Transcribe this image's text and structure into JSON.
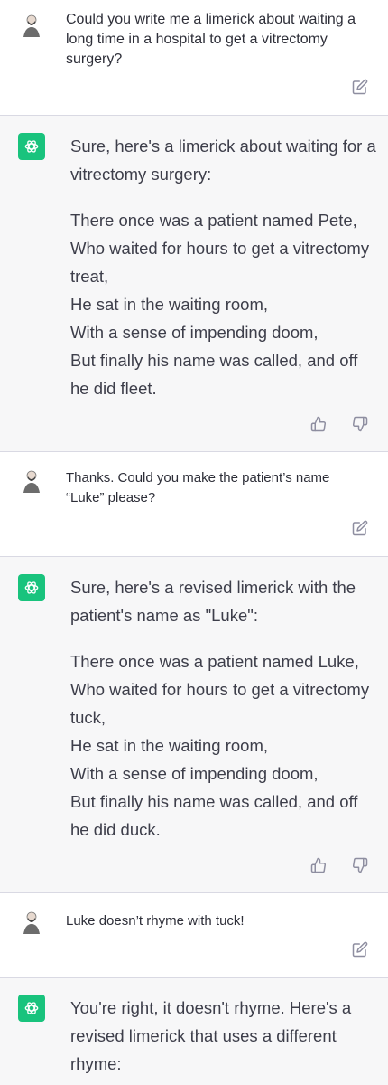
{
  "conversation": {
    "messages": [
      {
        "role": "user",
        "text": "Could you write me a limerick about waiting a long time in a hospital to get a vitrectomy surgery?"
      },
      {
        "role": "assistant",
        "intro": "Sure, here's a limerick about waiting for a vitrectomy surgery:",
        "lines": [
          "There once was a patient named Pete,",
          "Who waited for hours to get a vitrectomy treat,",
          "He sat in the waiting room,",
          "With a sense of impending doom,",
          "But finally his name was called, and off he did fleet."
        ]
      },
      {
        "role": "user",
        "text": "Thanks. Could you make the patient’s name “Luke” please?"
      },
      {
        "role": "assistant",
        "intro": "Sure, here's a revised limerick with the patient's name as \"Luke\":",
        "lines": [
          "There once was a patient named Luke,",
          "Who waited for hours to get a vitrectomy tuck,",
          "He sat in the waiting room,",
          "With a sense of impending doom,",
          "But finally his name was called, and off he did duck."
        ]
      },
      {
        "role": "user",
        "text": "Luke doesn’t rhyme with tuck!"
      },
      {
        "role": "assistant",
        "intro": "You're right, it doesn't rhyme. Here's a revised limerick that uses a different rhyme:"
      }
    ]
  },
  "icons": {
    "user_avatar": "user-avatar-icon",
    "assistant_avatar": "openai-logo-icon",
    "edit": "edit-icon",
    "thumbs_up": "thumbs-up-icon",
    "thumbs_down": "thumbs-down-icon"
  },
  "colors": {
    "accent": "#19c37d",
    "assistant_bg": "#f7f7f8",
    "user_bg": "#ffffff",
    "icon": "#8e8ea0"
  }
}
